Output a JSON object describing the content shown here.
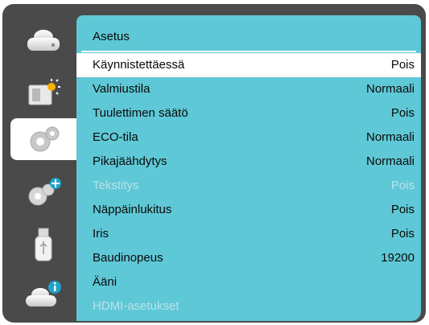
{
  "menu": {
    "title": "Asetus",
    "items": [
      {
        "label": "Käynnistettäessä",
        "value": "Pois"
      },
      {
        "label": "Valmiustila",
        "value": "Normaali"
      },
      {
        "label": "Tuulettimen säätö",
        "value": "Pois"
      },
      {
        "label": "ECO-tila",
        "value": "Normaali"
      },
      {
        "label": "Pikajäähdytys",
        "value": "Normaali"
      },
      {
        "label": "Tekstitys",
        "value": "Pois"
      },
      {
        "label": "Näppäinlukitus",
        "value": "Pois"
      },
      {
        "label": "Iris",
        "value": "Pois"
      },
      {
        "label": "Baudinopeus",
        "value": "19200"
      },
      {
        "label": "Ääni",
        "value": ""
      },
      {
        "label": "HDMI-asetukset",
        "value": ""
      }
    ]
  },
  "colors": {
    "panel": "#5fc8d6",
    "frame": "#4a4a4a",
    "selected_row": "#ffffff",
    "disabled_text": "#b8e2ea"
  },
  "sidebar": {
    "tabs": [
      {
        "icon": "camera-icon"
      },
      {
        "icon": "picture-brightness-icon"
      },
      {
        "icon": "settings-gears-icon"
      },
      {
        "icon": "expanded-settings-icon"
      },
      {
        "icon": "usb-icon"
      },
      {
        "icon": "info-icon"
      }
    ],
    "active_tab": 2
  }
}
